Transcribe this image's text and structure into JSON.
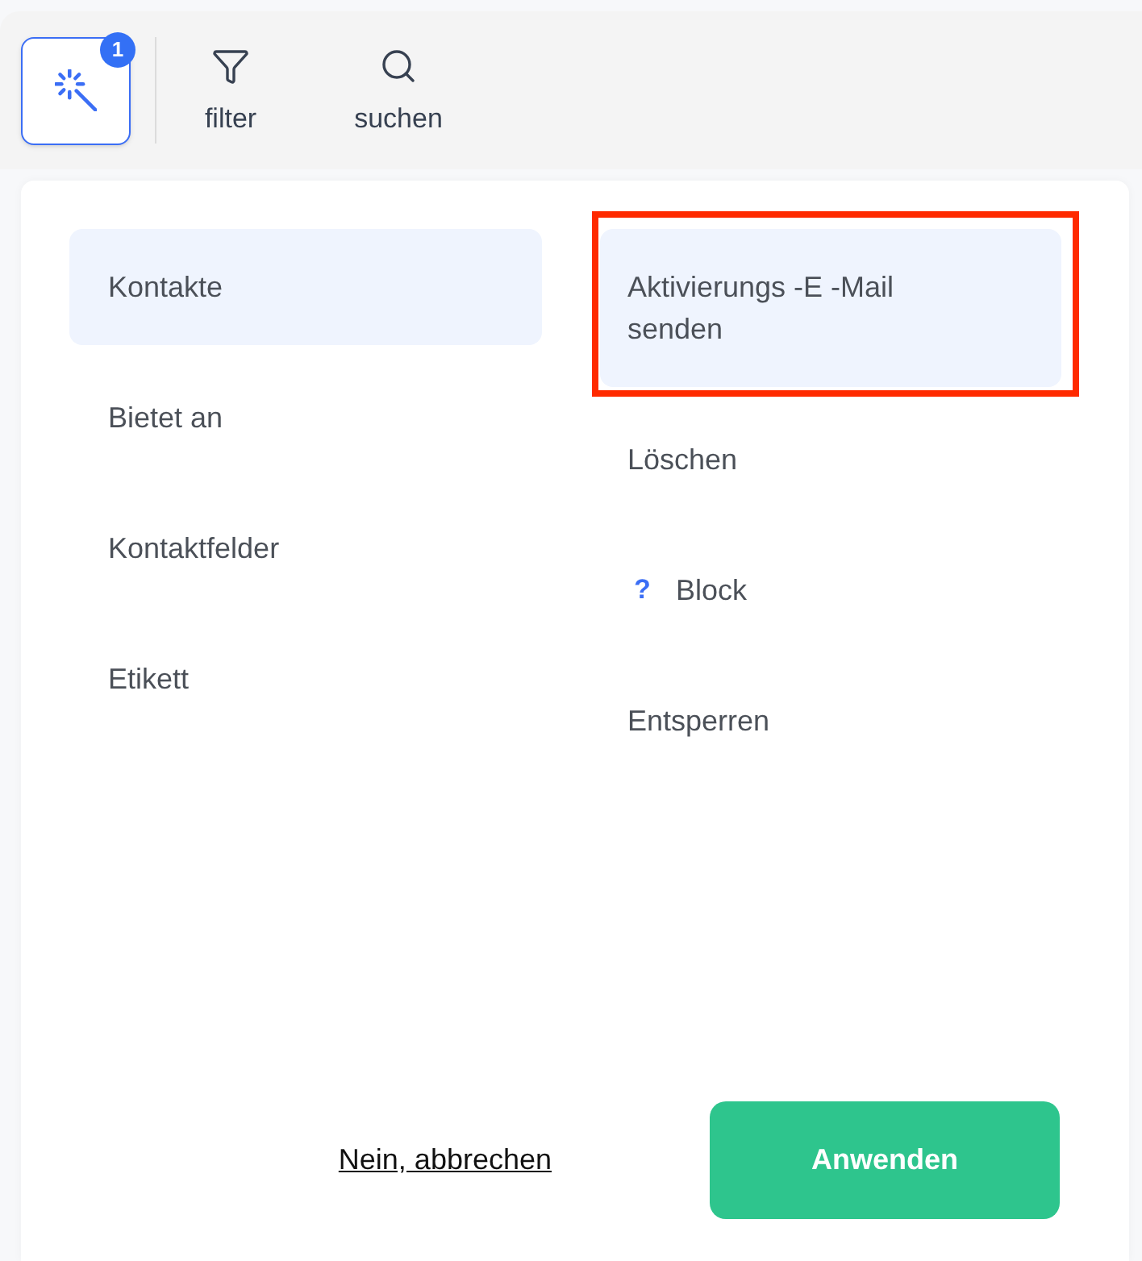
{
  "toolbar": {
    "buttons": [
      {
        "kind": "wand",
        "badge": "1",
        "selected": true
      },
      {
        "kind": "filter",
        "label": "filter",
        "selected": false
      },
      {
        "kind": "search",
        "label": "suchen",
        "selected": false
      }
    ]
  },
  "menu": {
    "categories": [
      {
        "label": "Kontakte",
        "selected": true
      },
      {
        "label": "Bietet an",
        "selected": false
      },
      {
        "label": "Kontaktfelder",
        "selected": false
      },
      {
        "label": "Etikett",
        "selected": false
      }
    ],
    "actions": [
      {
        "label": "Aktivierungs -E -Mail senden",
        "selected": true,
        "highlighted": true
      },
      {
        "label": "Löschen",
        "selected": false,
        "highlighted": false
      },
      {
        "label": "Block",
        "prefix": "?",
        "selected": false,
        "highlighted": false
      },
      {
        "label": "Entsperren",
        "selected": false,
        "highlighted": false
      }
    ]
  },
  "footer": {
    "cancel": "Nein, abbrechen",
    "apply": "Anwenden"
  }
}
